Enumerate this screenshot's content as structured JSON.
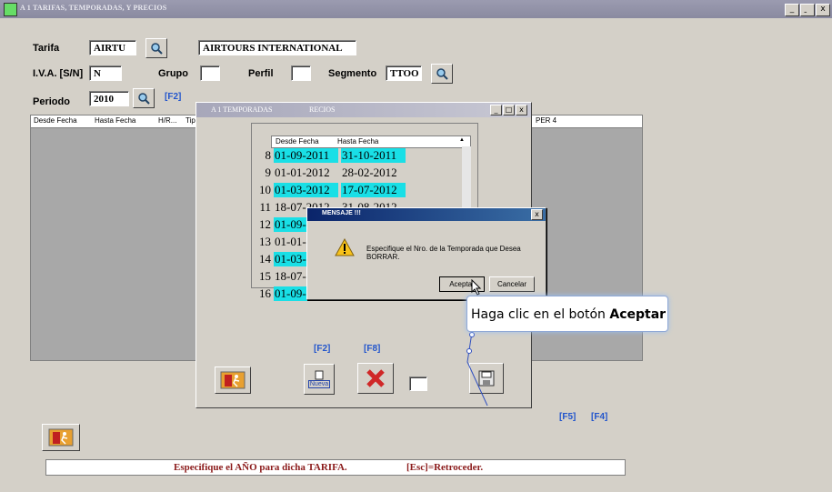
{
  "window": {
    "title": "A 1 TARIFAS, TEMPORADAS, Y PRECIOS",
    "btn_min": "_",
    "btn_max": "̱",
    "btn_close": "x"
  },
  "form": {
    "tarifa_label": "Tarifa",
    "tarifa_code": "AIRTU",
    "tarifa_name": "AIRTOURS INTERNATIONAL",
    "iva_label": "I.V.A. [S/N]",
    "iva_value": "N",
    "grupo_label": "Grupo",
    "grupo_value": "",
    "perfil_label": "Perfil",
    "perfil_value": "",
    "segmento_label": "Segmento",
    "segmento_value": "TTOO",
    "periodo_label": "Periodo",
    "periodo_value": "2010",
    "periodo_fkey": "[F2]"
  },
  "grid_headers": [
    "Desde Fecha",
    "Hasta Fecha",
    "H/R...",
    "Tip",
    "PER 4"
  ],
  "temporadas": {
    "title": "A 1 TEMPORADAS",
    "title_suffix": "RECIOS",
    "headers": [
      "Desde Fecha",
      "Hasta Fecha"
    ],
    "rows": [
      {
        "n": "8",
        "desde": "01-09-2011",
        "hasta": "31-10-2011",
        "hl": true
      },
      {
        "n": "9",
        "desde": "01-01-2012",
        "hasta": "28-02-2012",
        "hl": false
      },
      {
        "n": "10",
        "desde": "01-03-2012",
        "hasta": "17-07-2012",
        "hl": true
      },
      {
        "n": "11",
        "desde": "18-07-2012",
        "hasta": "31-08-2012",
        "hl": false
      },
      {
        "n": "12",
        "desde": "01-09-",
        "hasta": "",
        "hl": true
      },
      {
        "n": "13",
        "desde": "01-01-",
        "hasta": "",
        "hl": false
      },
      {
        "n": "14",
        "desde": "01-03-",
        "hasta": "",
        "hl": true
      },
      {
        "n": "15",
        "desde": "18-07-",
        "hasta": "",
        "hl": false
      },
      {
        "n": "16",
        "desde": "01-09-",
        "hasta": "",
        "hl": true
      }
    ],
    "fkey_f2": "[F2]",
    "fkey_f8": "[F8]",
    "nueva_label": "Nueva"
  },
  "mensaje": {
    "title": "MENSAJE !!!",
    "text": "Especifique el Nro. de la Temporada que Desea BORRAR.",
    "aceptar": "Aceptar",
    "cancelar": "Cancelar"
  },
  "tooltip": {
    "prefix": "Haga clic en el botón ",
    "bold": "Aceptar"
  },
  "fkeys": {
    "f5": "[F5]",
    "f4": "[F4]"
  },
  "status": {
    "left": "Especifique el AÑO para dicha TARIFA.",
    "right": "[Esc]=Retroceder."
  }
}
